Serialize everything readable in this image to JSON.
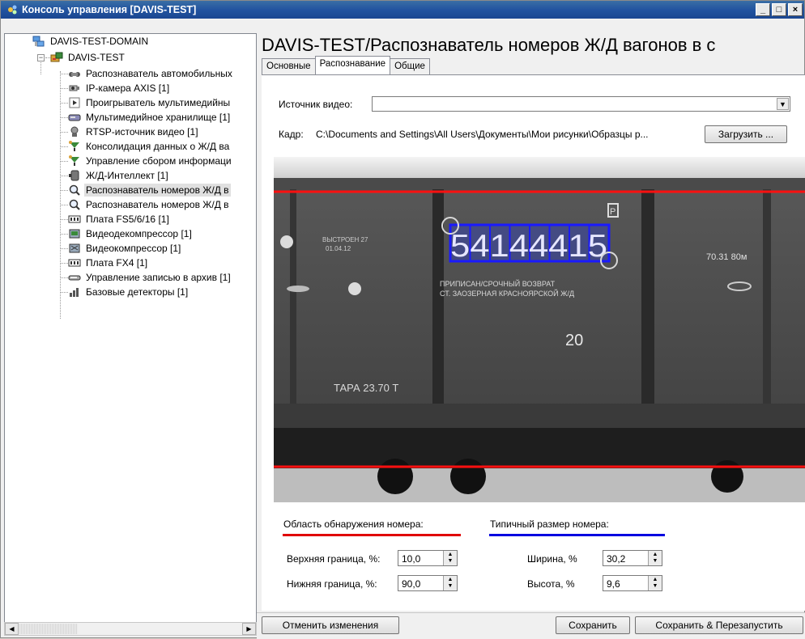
{
  "window": {
    "title": "Консоль управления [DAVIS-TEST]",
    "controls": {
      "minimize": "_",
      "maximize": "□",
      "close": "×"
    }
  },
  "tree": {
    "domain": "DAVIS-TEST-DOMAIN",
    "server": "DAVIS-TEST",
    "items": [
      {
        "label": "Распознаватель автомобильных",
        "icon": "car-plate-recognizer-icon"
      },
      {
        "label": "IP-камера AXIS [1]",
        "icon": "ip-camera-icon"
      },
      {
        "label": "Проигрыватель мультимедийны",
        "icon": "player-icon"
      },
      {
        "label": "Мультимедийное хранилище [1]",
        "icon": "storage-icon"
      },
      {
        "label": "RTSP-источник видео [1]",
        "icon": "rtsp-source-icon"
      },
      {
        "label": "Консолидация данных о Ж/Д ва",
        "icon": "consolidation-icon"
      },
      {
        "label": "Управление сбором информаци",
        "icon": "collection-icon"
      },
      {
        "label": "Ж/Д-Интеллект [1]",
        "icon": "rail-intellect-icon"
      },
      {
        "label": "Распознаватель номеров Ж/Д в",
        "icon": "magnifier-icon",
        "selected": true
      },
      {
        "label": "Распознаватель номеров Ж/Д в",
        "icon": "magnifier-icon"
      },
      {
        "label": "Плата FS5/6/16 [1]",
        "icon": "board-icon"
      },
      {
        "label": "Видеодекомпрессор [1]",
        "icon": "decompressor-icon"
      },
      {
        "label": "Видеокомпрессор [1]",
        "icon": "compressor-icon"
      },
      {
        "label": "Плата FX4 [1]",
        "icon": "board-icon"
      },
      {
        "label": "Управление записью в архив [1]",
        "icon": "archive-icon"
      },
      {
        "label": "Базовые детекторы [1]",
        "icon": "detectors-icon"
      }
    ]
  },
  "page_title": "DAVIS-TEST/Распознаватель номеров Ж/Д вагонов в с",
  "tabs": [
    {
      "label": "Основные",
      "active": false
    },
    {
      "label": "Распознавание",
      "active": true
    },
    {
      "label": "Общие",
      "active": false
    }
  ],
  "source": {
    "label": "Источник видео:",
    "value": ""
  },
  "frame": {
    "label": "Кадр:",
    "path": "C:\\Documents and Settings\\All Users\\Документы\\Мои рисунки\\Образцы р...",
    "load_button": "Загрузить ..."
  },
  "preview": {
    "number_digits": "54144415",
    "plate_text_1": "ВЫСТРОЕН 27",
    "plate_text_2": "01.04.12",
    "notice_1": "ПРИПИСАН/СРОЧНЫЙ ВОЗВРАТ",
    "notice_2": "СТ. ЗАОЗЕРНАЯ КРАСНОЯРСКОЙ Ж/Д",
    "big_number": "20",
    "tara": "ТАРА 23.70 Т",
    "spec": "70.31   80м",
    "p_mark": "P"
  },
  "detection_area": {
    "title": "Область обнаружения номера:",
    "top_label": "Верхняя граница, %:",
    "top_value": "10,0",
    "bottom_label": "Нижняя граница, %:",
    "bottom_value": "90,0",
    "color": "#e00000"
  },
  "typical_size": {
    "title": "Типичный размер номера:",
    "width_label": "Ширина, %",
    "width_value": "30,2",
    "height_label": "Высота, %",
    "height_value": "9,6",
    "color": "#0000e0"
  },
  "buttons": {
    "cancel": "Отменить изменения",
    "save": "Сохранить",
    "save_restart": "Сохранить & Перезапустить"
  }
}
